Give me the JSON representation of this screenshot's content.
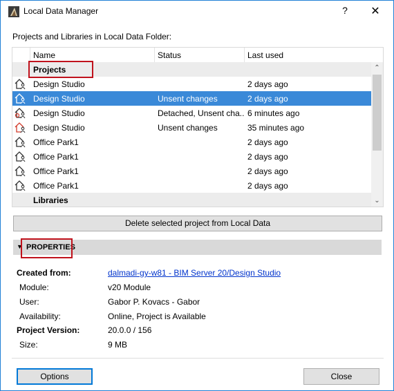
{
  "window": {
    "title": "Local Data Manager",
    "help_label": "?",
    "close_label": "✕"
  },
  "list": {
    "caption": "Projects and Libraries in Local Data Folder:",
    "columns": [
      "Name",
      "Status",
      "Last used"
    ],
    "groups": {
      "projects": "Projects",
      "libraries": "Libraries"
    },
    "rows": [
      {
        "name": "Design Studio",
        "status": "",
        "last_used": "2 days ago",
        "icon": "teamwork-project-icon"
      },
      {
        "name": "Design Studio",
        "status": "Unsent changes",
        "last_used": "2 days ago",
        "icon": "teamwork-project-unsent-icon",
        "selected": true
      },
      {
        "name": "Design Studio",
        "status": "Detached, Unsent cha...",
        "last_used": "6 minutes ago",
        "icon": "teamwork-project-detached-icon"
      },
      {
        "name": "Design Studio",
        "status": "Unsent changes",
        "last_used": "35 minutes ago",
        "icon": "teamwork-project-unsent-icon"
      },
      {
        "name": "Office Park1",
        "status": "",
        "last_used": "2 days ago",
        "icon": "teamwork-project-icon"
      },
      {
        "name": "Office Park1",
        "status": "",
        "last_used": "2 days ago",
        "icon": "teamwork-project-icon"
      },
      {
        "name": "Office Park1",
        "status": "",
        "last_used": "2 days ago",
        "icon": "teamwork-project-icon"
      },
      {
        "name": "Office Park1",
        "status": "",
        "last_used": "2 days ago",
        "icon": "teamwork-project-icon"
      }
    ]
  },
  "actions": {
    "delete_label": "Delete selected project from Local Data"
  },
  "properties": {
    "title": "PROPERTIES",
    "created_from_label": "Created from:",
    "created_from_value": "dalmadi-gy-w81 - BIM Server 20/Design Studio",
    "module_label": "Module:",
    "module_value": "v20 Module",
    "user_label": "User:",
    "user_value": "Gabor P. Kovacs - Gabor",
    "availability_label": "Availability:",
    "availability_value": "Online, Project is Available",
    "version_label": "Project Version:",
    "version_value": "20.0.0 / 156",
    "size_label": "Size:",
    "size_value": "9 MB"
  },
  "footer": {
    "options_label": "Options",
    "close_label": "Close"
  },
  "colors": {
    "selection": "#3a89d8",
    "highlight": "#c0121c",
    "link": "#0033cc",
    "window_border": "#1e7fd6"
  }
}
